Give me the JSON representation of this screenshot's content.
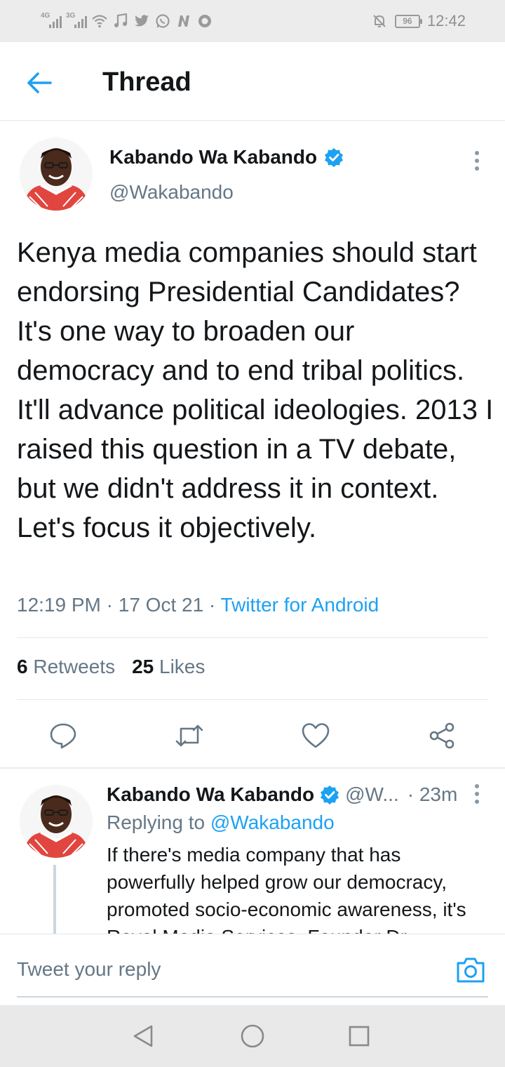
{
  "status_bar": {
    "network1": "4G",
    "network2": "3G",
    "battery": "96",
    "time": "12:42",
    "icons": [
      "signal-icon",
      "wifi-icon",
      "music-icon",
      "twitter-icon",
      "whatsapp-icon",
      "n-icon",
      "circle-icon",
      "mute-icon",
      "battery-icon"
    ]
  },
  "header": {
    "title": "Thread"
  },
  "main_tweet": {
    "name": "Kabando Wa Kabando",
    "handle": "@Wakabando",
    "text": "Kenya media companies should start endorsing Presidential Candidates? It's one way to broaden our democracy and to end tribal politics. It'll advance political ideologies. 2013 I raised this question in a TV debate, but we didn't address it in context. Let's focus it objectively.",
    "time": "12:19 PM",
    "date": "17 Oct 21",
    "source": "Twitter for Android",
    "retweets_count": "6",
    "retweets_label": "Retweets",
    "likes_count": "25",
    "likes_label": "Likes"
  },
  "reply_tweet": {
    "name": "Kabando Wa Kabando",
    "handle": "@W...",
    "age": "23m",
    "replying_label": "Replying to",
    "replying_handle": "@Wakabando",
    "text": "If there's media company that has powerfully helped grow our democracy, promoted socio-economic awareness, it's Royal Media Services. Founder Dr."
  },
  "compose": {
    "placeholder": "Tweet your reply"
  },
  "colors": {
    "accent": "#1da1f2",
    "secondary_text": "#657786",
    "divider": "#e1e8ed"
  }
}
